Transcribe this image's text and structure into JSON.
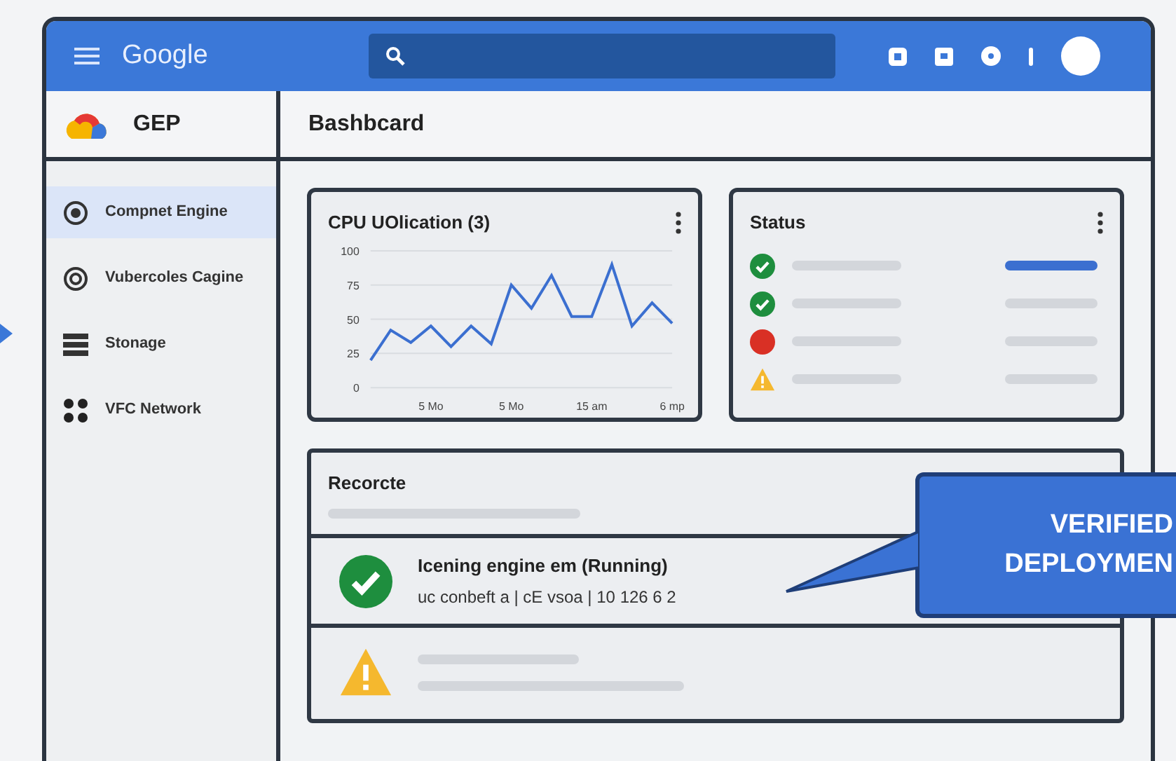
{
  "topbar": {
    "brand": "Google"
  },
  "sidebar": {
    "project": "GEP",
    "items": [
      {
        "label": "Compnet Engine",
        "selected": true,
        "kind": "target"
      },
      {
        "label": "Vubercoles Cagine",
        "selected": false,
        "kind": "ring"
      },
      {
        "label": "Stonage",
        "selected": false,
        "kind": "storage"
      },
      {
        "label": "VFC Network",
        "selected": false,
        "kind": "grid"
      }
    ]
  },
  "main": {
    "title": "Bashbcard",
    "cpu_card": {
      "title": "CPU UOlication (3)",
      "chart_data": {
        "type": "line",
        "grid": true,
        "categories": [
          null,
          null,
          null,
          "5 Mo",
          null,
          null,
          null,
          "5 Mo",
          null,
          null,
          null,
          "15 am",
          null,
          null,
          null,
          "6 mp"
        ],
        "series": [
          {
            "color": "#3b6fd0",
            "values": [
              20,
              42,
              33,
              45,
              30,
              45,
              32,
              75,
              58,
              82,
              52,
              52,
              90,
              45,
              62,
              47
            ]
          }
        ],
        "ylim": [
          0,
          100
        ],
        "yticks": [
          {
            "value": 0,
            "label": "0"
          },
          {
            "value": 25,
            "label": "25"
          },
          {
            "value": 50,
            "label": "50"
          },
          {
            "value": 75,
            "label": "75"
          },
          {
            "value": 100,
            "label": "100"
          }
        ]
      }
    },
    "status_card": {
      "title": "Status",
      "rows": [
        {
          "kind": "check",
          "color": "#1e8e3e",
          "selected": true
        },
        {
          "kind": "check",
          "color": "#1e8e3e",
          "selected": false
        },
        {
          "kind": "error",
          "color": "#d93025",
          "selected": false
        },
        {
          "kind": "warning",
          "color": "#f5b82e",
          "selected": false
        }
      ]
    },
    "resources": {
      "title": "Recorcte",
      "rows": [
        {
          "kind": "ok",
          "title": "Icening engine em (Running)",
          "subtitle": "uc conbeft a | cE vsoa | 10 126 6 2"
        },
        {
          "kind": "warning"
        }
      ]
    }
  },
  "callout": {
    "lines": [
      "VERIFIED",
      "DEPLOYMEN"
    ]
  }
}
